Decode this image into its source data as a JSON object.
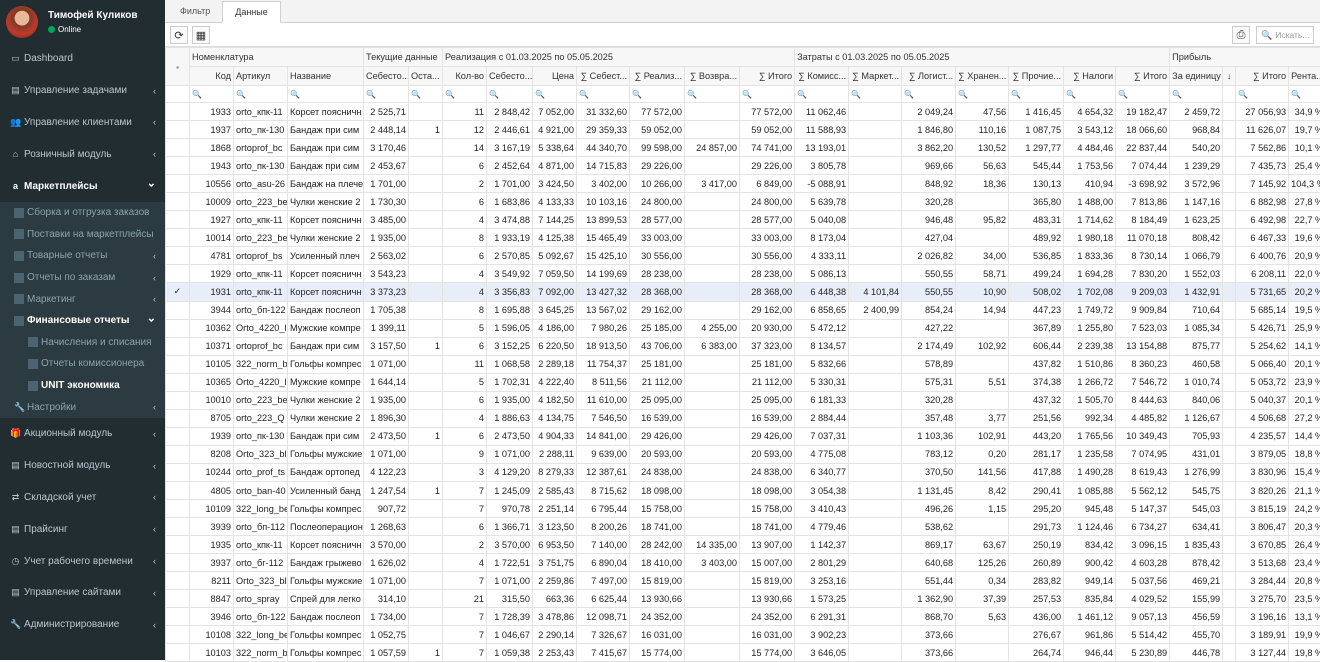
{
  "user": {
    "name": "Тимофей Куликов",
    "status": "Online"
  },
  "menu": [
    {
      "label": "Dashboard",
      "icon": "monitor-icon",
      "chevron": false
    },
    {
      "label": "Управление задачами",
      "icon": "tasks-icon",
      "chevron": true
    },
    {
      "label": "Управление клиентами",
      "icon": "users-icon",
      "chevron": true
    },
    {
      "label": "Розничный модуль",
      "icon": "bank-icon",
      "chevron": true
    },
    {
      "label": "Маркетплейсы",
      "icon": "amazon-icon",
      "chevron": true,
      "active": true,
      "children": [
        {
          "label": "Сборка и отгрузка заказов",
          "icon": "table-icon"
        },
        {
          "label": "Поставки на маркетплейсы",
          "icon": "table-icon"
        },
        {
          "label": "Товарные отчеты",
          "icon": "table-icon",
          "chevron": true
        },
        {
          "label": "Отчеты по заказам",
          "icon": "table-icon",
          "chevron": true
        },
        {
          "label": "Маркетинг",
          "icon": "table-icon",
          "chevron": true
        },
        {
          "label": "Финансовые отчеты",
          "icon": "table-icon",
          "chevron": true,
          "active": true,
          "children": [
            {
              "label": "Начисления и списания",
              "icon": "grid-icon"
            },
            {
              "label": "Отчеты комиссионера",
              "icon": "grid-icon"
            },
            {
              "label": "UNIT экономика",
              "icon": "grid-icon",
              "current": true
            }
          ]
        },
        {
          "label": "Настройки",
          "icon": "wrench-icon",
          "chevron": true
        }
      ]
    },
    {
      "label": "Акционный модуль",
      "icon": "gift-icon",
      "chevron": true
    },
    {
      "label": "Новостной модуль",
      "icon": "news-icon",
      "chevron": true
    },
    {
      "label": "Складской учет",
      "icon": "exchange-icon",
      "chevron": true
    },
    {
      "label": "Прайсинг",
      "icon": "price-icon",
      "chevron": true
    },
    {
      "label": "Учет рабочего времени",
      "icon": "clock-icon",
      "chevron": true
    },
    {
      "label": "Управление сайтами",
      "icon": "sites-icon",
      "chevron": true
    },
    {
      "label": "Администрирование",
      "icon": "wrench-icon",
      "chevron": true
    }
  ],
  "tabs": [
    "Фильтр",
    "Данные"
  ],
  "active_tab": 1,
  "search_placeholder": "Искать...",
  "bands": [
    {
      "label": "",
      "span": 1
    },
    {
      "label": "Номенклатура",
      "span": 3
    },
    {
      "label": "Текущие данные",
      "span": 2
    },
    {
      "label": "Реализация с 01.03.2025 по 05.05.2025",
      "span": 7
    },
    {
      "label": "Затраты с 01.03.2025 по 05.05.2025",
      "span": 7
    },
    {
      "label": "Прибыль",
      "span": 4
    }
  ],
  "columns": [
    "",
    "Код",
    "Артикул",
    "Название",
    "Себесто...",
    "Оста...",
    "Кол-во",
    "Себесто...",
    "Цена",
    "∑ Себест...",
    "∑ Реализ...",
    "∑ Возвра...",
    "∑ Итого",
    "∑ Комисс...",
    "∑ Маркет...",
    "∑ Логист...",
    "∑ Хранен...",
    "∑ Прочие...",
    "∑ Налоги",
    "∑ Итого",
    "За единицу",
    "↓",
    "∑ Итого",
    "Рента..."
  ],
  "rows": [
    [
      "",
      "1933",
      "orto_кпк-11",
      "Корсет поясничн",
      "2 525,71",
      "",
      "11",
      "2 848,42",
      "7 052,00",
      "31 332,60",
      "77 572,00",
      "",
      "77 572,00",
      "11 062,46",
      "",
      "2 049,24",
      "47,56",
      "1 416,45",
      "4 654,32",
      "19 182,47",
      "2 459,72",
      "",
      "27 056,93",
      "34,9 %"
    ],
    [
      "",
      "1937",
      "orto_пк-130",
      "Бандаж при сим",
      "2 448,14",
      "1",
      "12",
      "2 446,61",
      "4 921,00",
      "29 359,33",
      "59 052,00",
      "",
      "59 052,00",
      "11 588,93",
      "",
      "1 846,80",
      "110,16",
      "1 087,75",
      "3 543,12",
      "18 066,60",
      "968,84",
      "",
      "11 626,07",
      "19,7 %"
    ],
    [
      "",
      "1868",
      "ortoprof_bc",
      "Бандаж при сим",
      "3 170,46",
      "",
      "14",
      "3 167,19",
      "5 338,64",
      "44 340,70",
      "99 598,00",
      "24 857,00",
      "74 741,00",
      "13 193,01",
      "",
      "3 862,20",
      "130,52",
      "1 297,77",
      "4 484,46",
      "22 837,44",
      "540,20",
      "",
      "7 562,86",
      "10,1 %"
    ],
    [
      "",
      "1943",
      "orto_пк-130",
      "Бандаж при сим",
      "2 453,67",
      "",
      "6",
      "2 452,64",
      "4 871,00",
      "14 715,83",
      "29 226,00",
      "",
      "29 226,00",
      "3 805,78",
      "",
      "969,66",
      "56,63",
      "545,44",
      "1 753,56",
      "7 074,44",
      "1 239,29",
      "",
      "7 435,73",
      "25,4 %"
    ],
    [
      "",
      "10556",
      "orto_asu-26",
      "Бандаж на плече",
      "1 701,00",
      "",
      "2",
      "1 701,00",
      "3 424,50",
      "3 402,00",
      "10 266,00",
      "3 417,00",
      "6 849,00",
      "-5 088,91",
      "",
      "848,92",
      "18,36",
      "130,13",
      "410,94",
      "-3 698,92",
      "3 572,96",
      "",
      "7 145,92",
      "104,3 %"
    ],
    [
      "",
      "10009",
      "orto_223_be",
      "Чулки женские 2",
      "1 730,30",
      "",
      "6",
      "1 683,86",
      "4 133,33",
      "10 103,16",
      "24 800,00",
      "",
      "24 800,00",
      "5 639,78",
      "",
      "320,28",
      "",
      "365,80",
      "1 488,00",
      "7 813,86",
      "1 147,16",
      "",
      "6 882,98",
      "27,8 %"
    ],
    [
      "",
      "1927",
      "orto_кпк-11",
      "Корсет поясничн",
      "3 485,00",
      "",
      "4",
      "3 474,88",
      "7 144,25",
      "13 899,53",
      "28 577,00",
      "",
      "28 577,00",
      "5 040,08",
      "",
      "946,48",
      "95,82",
      "483,31",
      "1 714,62",
      "8 184,49",
      "1 623,25",
      "",
      "6 492,98",
      "22,7 %"
    ],
    [
      "",
      "10014",
      "orto_223_be",
      "Чулки женские 2",
      "1 935,00",
      "",
      "8",
      "1 933,19",
      "4 125,38",
      "15 465,49",
      "33 003,00",
      "",
      "33 003,00",
      "8 173,04",
      "",
      "427,04",
      "",
      "489,92",
      "1 980,18",
      "11 070,18",
      "808,42",
      "",
      "6 467,33",
      "19,6 %"
    ],
    [
      "",
      "4781",
      "ortoprof_bs",
      "Усиленный плеч",
      "2 563,02",
      "",
      "6",
      "2 570,85",
      "5 092,67",
      "15 425,10",
      "30 556,00",
      "",
      "30 556,00",
      "4 333,11",
      "",
      "2 026,82",
      "34,00",
      "536,85",
      "1 833,36",
      "8 730,14",
      "1 066,79",
      "",
      "6 400,76",
      "20,9 %"
    ],
    [
      "",
      "1929",
      "orto_кпк-11",
      "Корсет поясничн",
      "3 543,23",
      "",
      "4",
      "3 549,92",
      "7 059,50",
      "14 199,69",
      "28 238,00",
      "",
      "28 238,00",
      "5 086,13",
      "",
      "550,55",
      "58,71",
      "499,24",
      "1 694,28",
      "7 830,20",
      "1 552,03",
      "",
      "6 208,11",
      "22,0 %"
    ],
    [
      "✓",
      "1931",
      "orto_кпк-11",
      "Корсет поясничн",
      "3 373,23",
      "",
      "4",
      "3 356,83",
      "7 092,00",
      "13 427,32",
      "28 368,00",
      "",
      "28 368,00",
      "6 448,38",
      "4 101,84",
      "550,55",
      "10,90",
      "508,02",
      "1 702,08",
      "9 209,03",
      "1 432,91",
      "",
      "5 731,65",
      "20,2 %"
    ],
    [
      "",
      "3944",
      "orto_бп-122",
      "Бандаж послеоп",
      "1 705,38",
      "",
      "8",
      "1 695,88",
      "3 645,25",
      "13 567,02",
      "29 162,00",
      "",
      "29 162,00",
      "6 858,65",
      "2 400,99",
      "854,24",
      "14,94",
      "447,23",
      "1 749,72",
      "9 909,84",
      "710,64",
      "",
      "5 685,14",
      "19,5 %"
    ],
    [
      "",
      "10362",
      "Orto_4220_l",
      "Мужские компре",
      "1 399,11",
      "",
      "5",
      "1 596,05",
      "4 186,00",
      "7 980,26",
      "25 185,00",
      "4 255,00",
      "20 930,00",
      "5 472,12",
      "",
      "427,22",
      "",
      "367,89",
      "1 255,80",
      "7 523,03",
      "1 085,34",
      "",
      "5 426,71",
      "25,9 %"
    ],
    [
      "",
      "10371",
      "ortoprof_bc",
      "Бандаж при сим",
      "3 157,50",
      "1",
      "6",
      "3 152,25",
      "6 220,50",
      "18 913,50",
      "43 706,00",
      "6 383,00",
      "37 323,00",
      "8 134,57",
      "",
      "2 174,49",
      "102,92",
      "606,44",
      "2 239,38",
      "13 154,88",
      "875,77",
      "",
      "5 254,62",
      "14,1 %"
    ],
    [
      "",
      "10105",
      "322_norm_b",
      "Гольфы компрес",
      "1 071,00",
      "",
      "11",
      "1 068,58",
      "2 289,18",
      "11 754,37",
      "25 181,00",
      "",
      "25 181,00",
      "5 832,66",
      "",
      "578,89",
      "",
      "437,82",
      "1 510,86",
      "8 360,23",
      "460,58",
      "",
      "5 066,40",
      "20,1 %"
    ],
    [
      "",
      "10365",
      "Orto_4220_l",
      "Мужские компре",
      "1 644,14",
      "",
      "5",
      "1 702,31",
      "4 222,40",
      "8 511,56",
      "21 112,00",
      "",
      "21 112,00",
      "5 330,31",
      "",
      "575,31",
      "5,51",
      "374,38",
      "1 266,72",
      "7 546,72",
      "1 010,74",
      "",
      "5 053,72",
      "23,9 %"
    ],
    [
      "",
      "10010",
      "orto_223_be",
      "Чулки женские 2",
      "1 935,00",
      "",
      "6",
      "1 935,00",
      "4 182,50",
      "11 610,00",
      "25 095,00",
      "",
      "25 095,00",
      "6 181,33",
      "",
      "320,28",
      "",
      "437,32",
      "1 505,70",
      "8 444,63",
      "840,06",
      "",
      "5 040,37",
      "20,1 %"
    ],
    [
      "",
      "8705",
      "orto_223_Q",
      "Чулки женские 2",
      "1 896,30",
      "",
      "4",
      "1 886,63",
      "4 134,75",
      "7 546,50",
      "16 539,00",
      "",
      "16 539,00",
      "2 884,44",
      "",
      "357,48",
      "3,77",
      "251,56",
      "992,34",
      "4 485,82",
      "1 126,67",
      "",
      "4 506,68",
      "27,2 %"
    ],
    [
      "",
      "1939",
      "orto_пк-130",
      "Бандаж при сим",
      "2 473,50",
      "1",
      "6",
      "2 473,50",
      "4 904,33",
      "14 841,00",
      "29 426,00",
      "",
      "29 426,00",
      "7 037,31",
      "",
      "1 103,36",
      "102,91",
      "443,20",
      "1 765,56",
      "10 349,43",
      "705,93",
      "",
      "4 235,57",
      "14,4 %"
    ],
    [
      "",
      "8208",
      "Orto_323_bl",
      "Гольфы мужские",
      "1 071,00",
      "",
      "9",
      "1 071,00",
      "2 288,11",
      "9 639,00",
      "20 593,00",
      "",
      "20 593,00",
      "4 775,08",
      "",
      "783,12",
      "0,20",
      "281,17",
      "1 235,58",
      "7 074,95",
      "431,01",
      "",
      "3 879,05",
      "18,8 %"
    ],
    [
      "",
      "10244",
      "orto_prof_ts",
      "Бандаж ортопед",
      "4 122,23",
      "",
      "3",
      "4 129,20",
      "8 279,33",
      "12 387,61",
      "24 838,00",
      "",
      "24 838,00",
      "6 340,77",
      "",
      "370,50",
      "141,56",
      "417,88",
      "1 490,28",
      "8 619,43",
      "1 276,99",
      "",
      "3 830,96",
      "15,4 %"
    ],
    [
      "",
      "4805",
      "orto_ban-40",
      "Усиленный банд",
      "1 247,54",
      "1",
      "7",
      "1 245,09",
      "2 585,43",
      "8 715,62",
      "18 098,00",
      "",
      "18 098,00",
      "3 054,38",
      "",
      "1 131,45",
      "8,42",
      "290,41",
      "1 085,88",
      "5 562,12",
      "545,75",
      "",
      "3 820,26",
      "21,1 %"
    ],
    [
      "",
      "10109",
      "322_long_be",
      "Гольфы компрес",
      "907,72",
      "",
      "7",
      "970,78",
      "2 251,14",
      "6 795,44",
      "15 758,00",
      "",
      "15 758,00",
      "3 410,43",
      "",
      "496,26",
      "1,15",
      "295,20",
      "945,48",
      "5 147,37",
      "545,03",
      "",
      "3 815,19",
      "24,2 %"
    ],
    [
      "",
      "3939",
      "orto_бп-112",
      "Послеоперацион",
      "1 268,63",
      "",
      "6",
      "1 366,71",
      "3 123,50",
      "8 200,26",
      "18 741,00",
      "",
      "18 741,00",
      "4 779,46",
      "",
      "538,62",
      "",
      "291,73",
      "1 124,46",
      "6 734,27",
      "634,41",
      "",
      "3 806,47",
      "20,3 %"
    ],
    [
      "",
      "1935",
      "orto_кпк-11",
      "Корсет поясничн",
      "3 570,00",
      "",
      "2",
      "3 570,00",
      "6 953,50",
      "7 140,00",
      "28 242,00",
      "14 335,00",
      "13 907,00",
      "1 142,37",
      "",
      "869,17",
      "63,67",
      "250,19",
      "834,42",
      "3 096,15",
      "1 835,43",
      "",
      "3 670,85",
      "26,4 %"
    ],
    [
      "",
      "3937",
      "orto_бг-112",
      "Бандаж грыжево",
      "1 626,02",
      "",
      "4",
      "1 722,51",
      "3 751,75",
      "6 890,04",
      "18 410,00",
      "3 403,00",
      "15 007,00",
      "2 801,29",
      "",
      "640,68",
      "125,26",
      "260,89",
      "900,42",
      "4 603,28",
      "878,42",
      "",
      "3 513,68",
      "23,4 %"
    ],
    [
      "",
      "8211",
      "Orto_323_bl",
      "Гольфы мужские",
      "1 071,00",
      "",
      "7",
      "1 071,00",
      "2 259,86",
      "7 497,00",
      "15 819,00",
      "",
      "15 819,00",
      "3 253,16",
      "",
      "551,44",
      "0,34",
      "283,82",
      "949,14",
      "5 037,56",
      "469,21",
      "",
      "3 284,44",
      "20,8 %"
    ],
    [
      "",
      "8847",
      "orto_spray",
      "Спрей для легко",
      "314,10",
      "",
      "21",
      "315,50",
      "663,36",
      "6 625,44",
      "13 930,66",
      "",
      "13 930,66",
      "1 573,25",
      "",
      "1 362,90",
      "37,39",
      "257,53",
      "835,84",
      "4 029,52",
      "155,99",
      "",
      "3 275,70",
      "23,5 %"
    ],
    [
      "",
      "3946",
      "orto_бп-122",
      "Бандаж послеоп",
      "1 734,00",
      "",
      "7",
      "1 728,39",
      "3 478,86",
      "12 098,71",
      "24 352,00",
      "",
      "24 352,00",
      "6 291,31",
      "",
      "868,70",
      "5,63",
      "436,00",
      "1 461,12",
      "9 057,13",
      "456,59",
      "",
      "3 196,16",
      "13,1 %"
    ],
    [
      "",
      "10108",
      "322_long_be",
      "Гольфы компрес",
      "1 052,75",
      "",
      "7",
      "1 046,67",
      "2 290,14",
      "7 326,67",
      "16 031,00",
      "",
      "16 031,00",
      "3 902,23",
      "",
      "373,66",
      "",
      "276,67",
      "961,86",
      "5 514,42",
      "455,70",
      "",
      "3 189,91",
      "19,9 %"
    ],
    [
      "",
      "10103",
      "322_norm_b",
      "Гольфы компрес",
      "1 057,59",
      "1",
      "7",
      "1 059,38",
      "2 253,43",
      "7 415,67",
      "15 774,00",
      "",
      "15 774,00",
      "3 646,05",
      "",
      "373,66",
      "",
      "264,74",
      "946,44",
      "5 230,89",
      "446,78",
      "",
      "3 127,44",
      "19,8 %"
    ]
  ]
}
